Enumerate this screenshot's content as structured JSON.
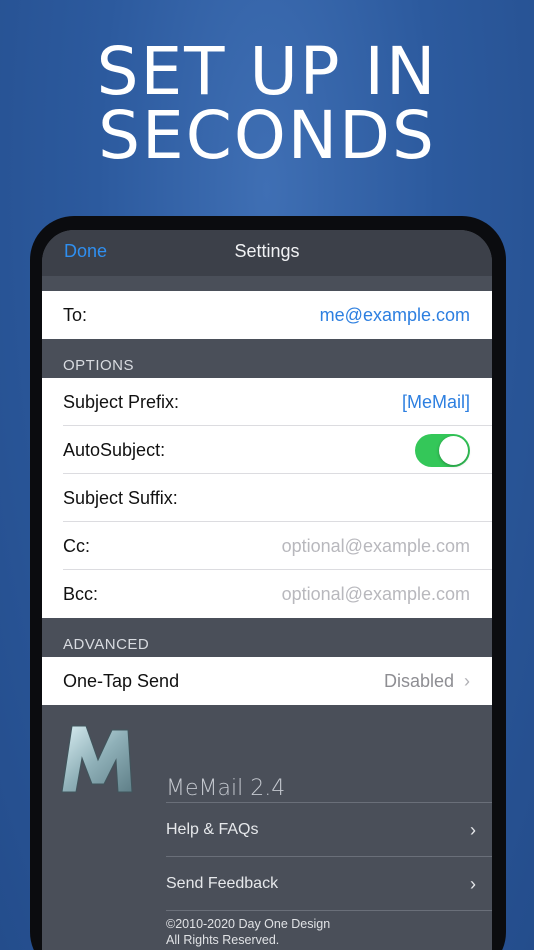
{
  "headline": {
    "line1": "SET UP IN",
    "line2": "SECONDS"
  },
  "nav": {
    "done_label": "Done",
    "title": "Settings"
  },
  "to_row": {
    "label": "To:",
    "value": "me@example.com"
  },
  "options": {
    "header": "OPTIONS",
    "subject_prefix": {
      "label": "Subject Prefix:",
      "value": "[MeMail]"
    },
    "autosubject": {
      "label": "AutoSubject:",
      "enabled": true
    },
    "subject_suffix": {
      "label": "Subject Suffix:"
    },
    "cc": {
      "label": "Cc:",
      "placeholder": "optional@example.com"
    },
    "bcc": {
      "label": "Bcc:",
      "placeholder": "optional@example.com"
    }
  },
  "advanced": {
    "header": "ADVANCED",
    "one_tap_send": {
      "label": "One-Tap Send",
      "value": "Disabled"
    }
  },
  "about": {
    "logo_letter": "M",
    "app_version": "MeMail 2.4",
    "help_label": "Help & FAQs",
    "feedback_label": "Send Feedback",
    "copyright_line1": "©2010-2020 Day One Design",
    "copyright_line2": "All Rights Reserved."
  },
  "colors": {
    "accent": "#2d7fe0",
    "toggle_on": "#34c759",
    "background": "#2c5a9e"
  }
}
